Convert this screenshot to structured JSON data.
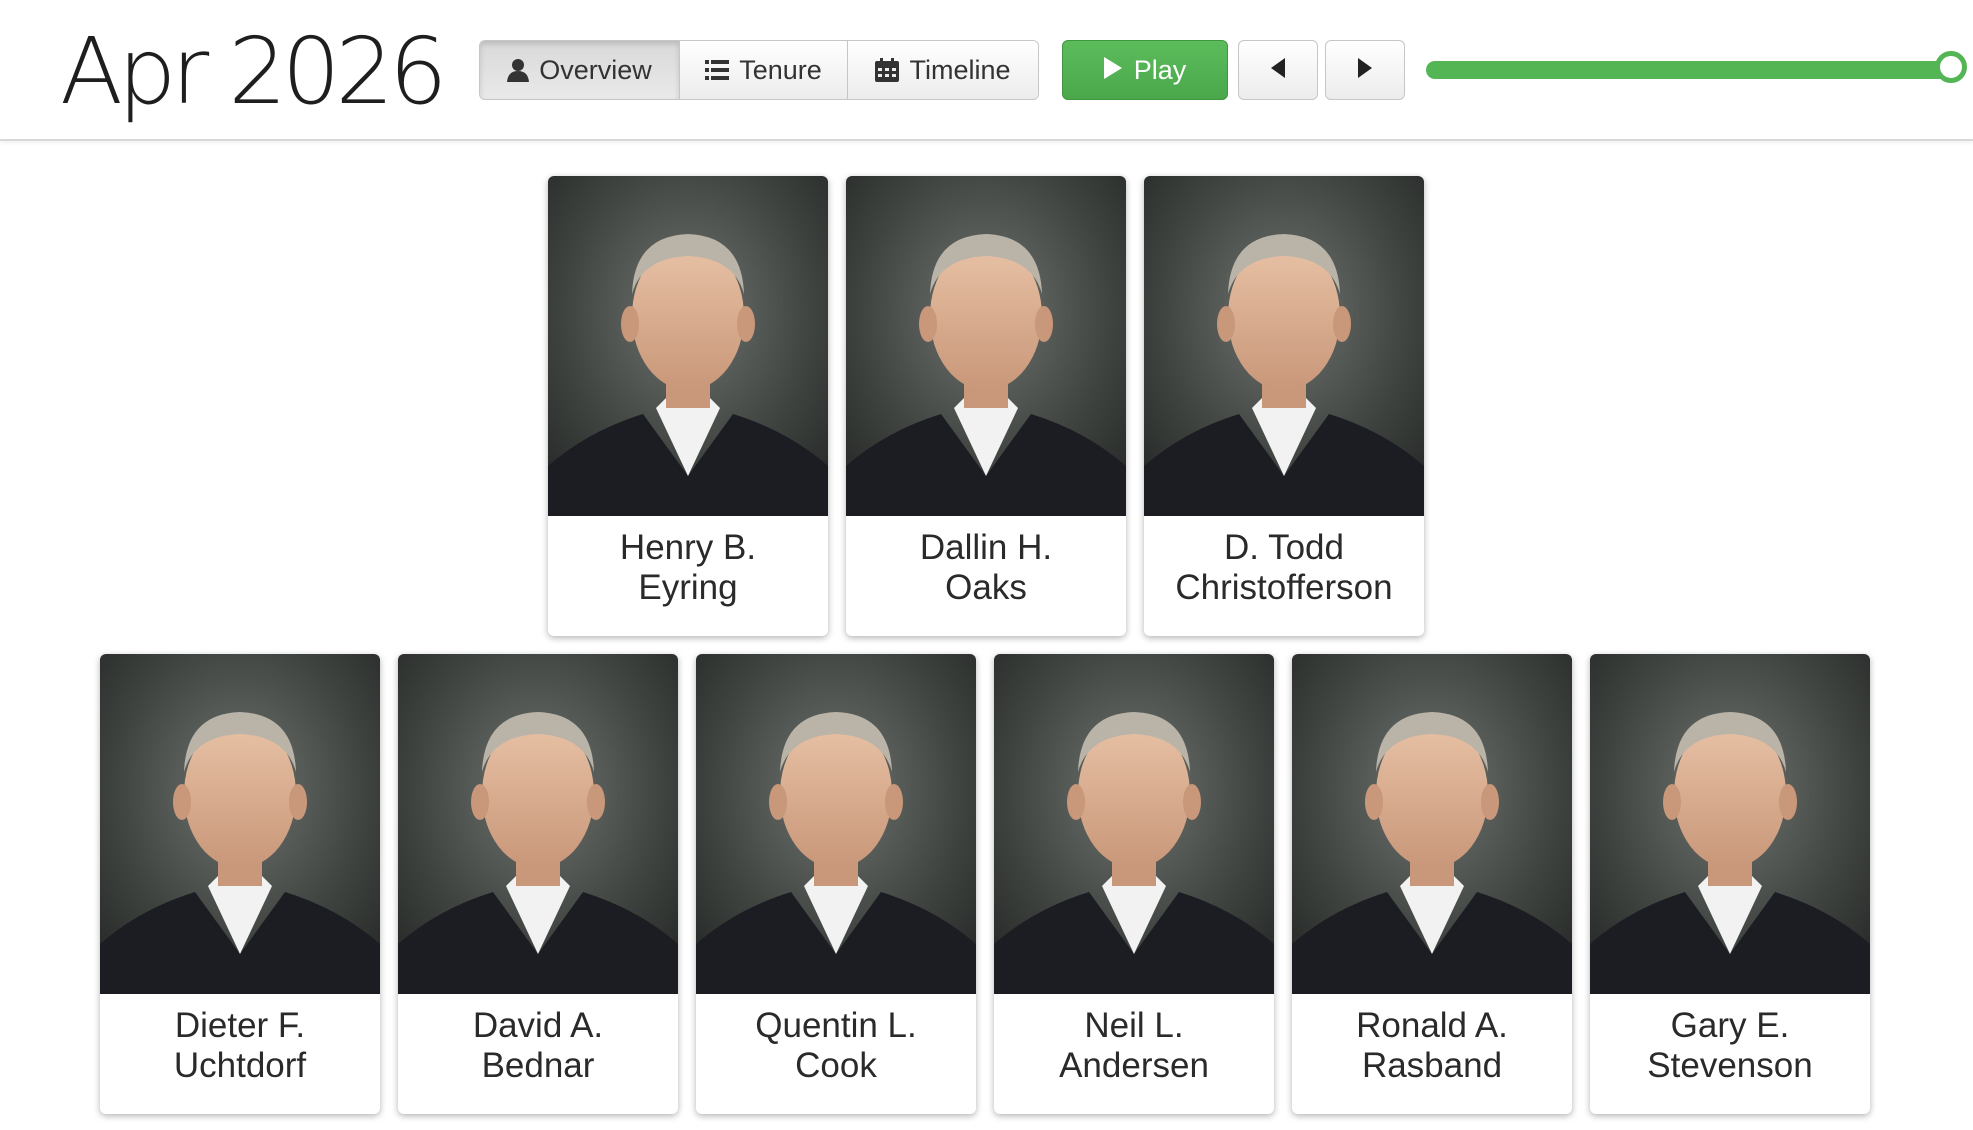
{
  "header": {
    "date": "Apr 2026",
    "view_tabs": [
      {
        "label": "Overview",
        "icon": "user-icon",
        "active": true
      },
      {
        "label": "Tenure",
        "icon": "list-icon",
        "active": false
      },
      {
        "label": "Timeline",
        "icon": "calendar-icon",
        "active": false
      }
    ],
    "play_label": "Play",
    "timeline_progress": 1.0,
    "colors": {
      "accent_green": "#53b553",
      "text": "#222222"
    }
  },
  "first_presidency": [
    {
      "first": "Henry B.",
      "last": "Eyring"
    },
    {
      "first": "Dallin H.",
      "last": "Oaks"
    },
    {
      "first": "D. Todd",
      "last": "Christofferson"
    }
  ],
  "apostles": [
    {
      "first": "Dieter F.",
      "last": "Uchtdorf"
    },
    {
      "first": "David A.",
      "last": "Bednar"
    },
    {
      "first": "Quentin L.",
      "last": "Cook"
    },
    {
      "first": "Neil L.",
      "last": "Andersen"
    },
    {
      "first": "Ronald A.",
      "last": "Rasband"
    },
    {
      "first": "Gary E.",
      "last": "Stevenson"
    }
  ]
}
